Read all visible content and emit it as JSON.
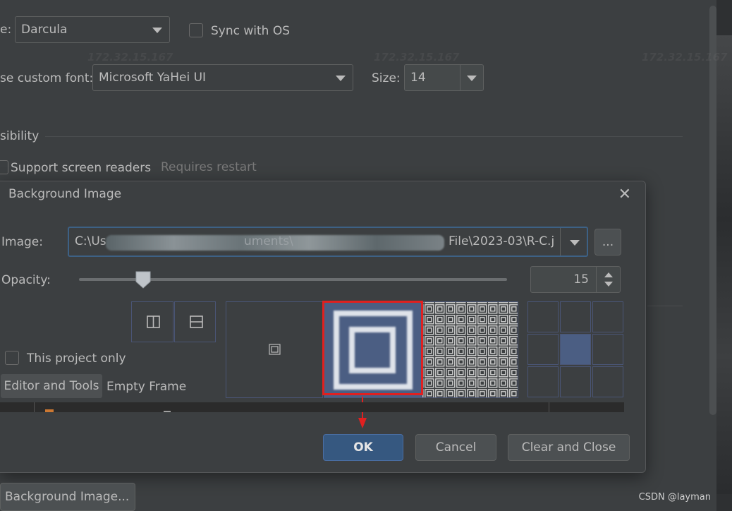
{
  "settings": {
    "theme_label": "e:",
    "theme_value": "Darcula",
    "sync_label": "Sync with OS",
    "font_label": "se custom font:",
    "font_value": "Microsoft YaHei UI",
    "size_label": "Size:",
    "size_value": "14",
    "accessibility_label": "sibility",
    "screen_readers_label": "Support screen readers",
    "requires_restart": "Requires restart"
  },
  "dialog": {
    "title": "Background Image",
    "close_glyph": "✕",
    "image_label": "Image:",
    "image_path_prefix": "C:\\Us",
    "image_path_middle": "uments\\",
    "image_path_suffix": "File\\2023-03\\R-C.j",
    "browse_label": "...",
    "opacity_label": "Opacity:",
    "opacity_value": "15",
    "opacity_fraction": 0.15,
    "this_project_only": "This project only",
    "tab_editor_tools": "Editor and Tools",
    "tab_empty_frame": "Empty Frame",
    "ok_label": "OK",
    "cancel_label": "Cancel",
    "clear_close_label": "Clear and Close",
    "selected_fill_mode": "scale",
    "selected_anchor": "center"
  },
  "footer": {
    "background_image_button": "Background Image...",
    "watermark": "CSDN @layman"
  },
  "colors": {
    "background": "#3c3f41",
    "accent": "#365880",
    "highlight": "#e02020",
    "tile_fill": "#4b5e83"
  }
}
